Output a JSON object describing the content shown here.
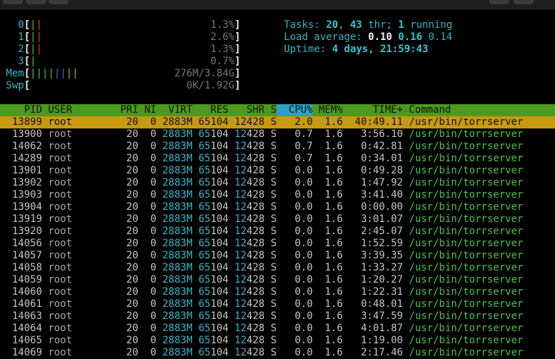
{
  "meters": {
    "cpus": [
      {
        "label": "0",
        "bars": "||",
        "pct": "1.3%"
      },
      {
        "label": "1",
        "bars": "||",
        "pct": "2.6%"
      },
      {
        "label": "2",
        "bars": "||",
        "pct": "1.3%"
      },
      {
        "label": "3",
        "bars": "|",
        "pct": "0.7%"
      }
    ],
    "mem": {
      "label": "Mem",
      "bars": "||||||||",
      "value": "276M/3.84G"
    },
    "swp": {
      "label": "Swp",
      "bars": "",
      "value": "0K/1.92G"
    }
  },
  "summary": {
    "tasks_label": "Tasks: ",
    "tasks": "20",
    "thr": "43",
    "thr_label": " thr; ",
    "running": "1",
    "running_label": " running",
    "load_label": "Load average: ",
    "load1": "0.10",
    "load5": "0.16",
    "load15": "0.14",
    "uptime_label": "Uptime: ",
    "uptime": "4 days, 21:59:43"
  },
  "columns": [
    "PID",
    "USER",
    "PRI",
    "NI",
    "VIRT",
    "RES",
    "SHR",
    "S",
    "CPU%",
    "MEM%",
    "TIME+",
    "Command"
  ],
  "sort_column": "CPU%",
  "colors": {
    "header": "#4c9a1d",
    "selected": "#c79a12",
    "sort": "#2fa2c4",
    "accent": "#34b7c7"
  },
  "processes": [
    {
      "pid": "13899",
      "user": "root",
      "pri": "20",
      "ni": "0",
      "virt": "2883M",
      "res": "65104",
      "shr": "12428",
      "s": "S",
      "cpu": "2.0",
      "mem": "1.6",
      "time": "40:49.11",
      "cmd": "/usr/bin/torrserver"
    },
    {
      "pid": "13900",
      "user": "root",
      "pri": "20",
      "ni": "0",
      "virt": "2883M",
      "res": "65104",
      "shr": "12428",
      "s": "S",
      "cpu": "0.7",
      "mem": "1.6",
      "time": "3:56.10",
      "cmd": "/usr/bin/torrserver"
    },
    {
      "pid": "14062",
      "user": "root",
      "pri": "20",
      "ni": "0",
      "virt": "2883M",
      "res": "65104",
      "shr": "12428",
      "s": "S",
      "cpu": "0.7",
      "mem": "1.6",
      "time": "0:42.81",
      "cmd": "/usr/bin/torrserver"
    },
    {
      "pid": "14289",
      "user": "root",
      "pri": "20",
      "ni": "0",
      "virt": "2883M",
      "res": "65104",
      "shr": "12428",
      "s": "S",
      "cpu": "0.7",
      "mem": "1.6",
      "time": "0:34.01",
      "cmd": "/usr/bin/torrserver"
    },
    {
      "pid": "13901",
      "user": "root",
      "pri": "20",
      "ni": "0",
      "virt": "2883M",
      "res": "65104",
      "shr": "12428",
      "s": "S",
      "cpu": "0.0",
      "mem": "1.6",
      "time": "0:49.28",
      "cmd": "/usr/bin/torrserver"
    },
    {
      "pid": "13902",
      "user": "root",
      "pri": "20",
      "ni": "0",
      "virt": "2883M",
      "res": "65104",
      "shr": "12428",
      "s": "S",
      "cpu": "0.0",
      "mem": "1.6",
      "time": "1:47.92",
      "cmd": "/usr/bin/torrserver"
    },
    {
      "pid": "13903",
      "user": "root",
      "pri": "20",
      "ni": "0",
      "virt": "2883M",
      "res": "65104",
      "shr": "12428",
      "s": "S",
      "cpu": "0.0",
      "mem": "1.6",
      "time": "3:41.40",
      "cmd": "/usr/bin/torrserver"
    },
    {
      "pid": "13904",
      "user": "root",
      "pri": "20",
      "ni": "0",
      "virt": "2883M",
      "res": "65104",
      "shr": "12428",
      "s": "S",
      "cpu": "0.0",
      "mem": "1.6",
      "time": "0:00.00",
      "cmd": "/usr/bin/torrserver"
    },
    {
      "pid": "13919",
      "user": "root",
      "pri": "20",
      "ni": "0",
      "virt": "2883M",
      "res": "65104",
      "shr": "12428",
      "s": "S",
      "cpu": "0.0",
      "mem": "1.6",
      "time": "3:01.07",
      "cmd": "/usr/bin/torrserver"
    },
    {
      "pid": "13920",
      "user": "root",
      "pri": "20",
      "ni": "0",
      "virt": "2883M",
      "res": "65104",
      "shr": "12428",
      "s": "S",
      "cpu": "0.0",
      "mem": "1.6",
      "time": "2:45.07",
      "cmd": "/usr/bin/torrserver"
    },
    {
      "pid": "14056",
      "user": "root",
      "pri": "20",
      "ni": "0",
      "virt": "2883M",
      "res": "65104",
      "shr": "12428",
      "s": "S",
      "cpu": "0.0",
      "mem": "1.6",
      "time": "1:52.59",
      "cmd": "/usr/bin/torrserver"
    },
    {
      "pid": "14057",
      "user": "root",
      "pri": "20",
      "ni": "0",
      "virt": "2883M",
      "res": "65104",
      "shr": "12428",
      "s": "S",
      "cpu": "0.0",
      "mem": "1.6",
      "time": "3:39.35",
      "cmd": "/usr/bin/torrserver"
    },
    {
      "pid": "14058",
      "user": "root",
      "pri": "20",
      "ni": "0",
      "virt": "2883M",
      "res": "65104",
      "shr": "12428",
      "s": "S",
      "cpu": "0.0",
      "mem": "1.6",
      "time": "1:33.27",
      "cmd": "/usr/bin/torrserver"
    },
    {
      "pid": "14059",
      "user": "root",
      "pri": "20",
      "ni": "0",
      "virt": "2883M",
      "res": "65104",
      "shr": "12428",
      "s": "S",
      "cpu": "0.0",
      "mem": "1.6",
      "time": "1:20.27",
      "cmd": "/usr/bin/torrserver"
    },
    {
      "pid": "14060",
      "user": "root",
      "pri": "20",
      "ni": "0",
      "virt": "2883M",
      "res": "65104",
      "shr": "12428",
      "s": "S",
      "cpu": "0.0",
      "mem": "1.6",
      "time": "1:22.31",
      "cmd": "/usr/bin/torrserver"
    },
    {
      "pid": "14061",
      "user": "root",
      "pri": "20",
      "ni": "0",
      "virt": "2883M",
      "res": "65104",
      "shr": "12428",
      "s": "S",
      "cpu": "0.0",
      "mem": "1.6",
      "time": "0:48.01",
      "cmd": "/usr/bin/torrserver"
    },
    {
      "pid": "14063",
      "user": "root",
      "pri": "20",
      "ni": "0",
      "virt": "2883M",
      "res": "65104",
      "shr": "12428",
      "s": "S",
      "cpu": "0.0",
      "mem": "1.6",
      "time": "3:47.59",
      "cmd": "/usr/bin/torrserver"
    },
    {
      "pid": "14064",
      "user": "root",
      "pri": "20",
      "ni": "0",
      "virt": "2883M",
      "res": "65104",
      "shr": "12428",
      "s": "S",
      "cpu": "0.0",
      "mem": "1.6",
      "time": "4:01.87",
      "cmd": "/usr/bin/torrserver"
    },
    {
      "pid": "14065",
      "user": "root",
      "pri": "20",
      "ni": "0",
      "virt": "2883M",
      "res": "65104",
      "shr": "12428",
      "s": "S",
      "cpu": "0.0",
      "mem": "1.6",
      "time": "1:19.00",
      "cmd": "/usr/bin/torrserver"
    },
    {
      "pid": "14069",
      "user": "root",
      "pri": "20",
      "ni": "0",
      "virt": "2883M",
      "res": "65104",
      "shr": "12428",
      "s": "S",
      "cpu": "0.0",
      "mem": "1.6",
      "time": "2:17.46",
      "cmd": "/usr/bin/torrserver"
    }
  ],
  "selected_index": 0
}
